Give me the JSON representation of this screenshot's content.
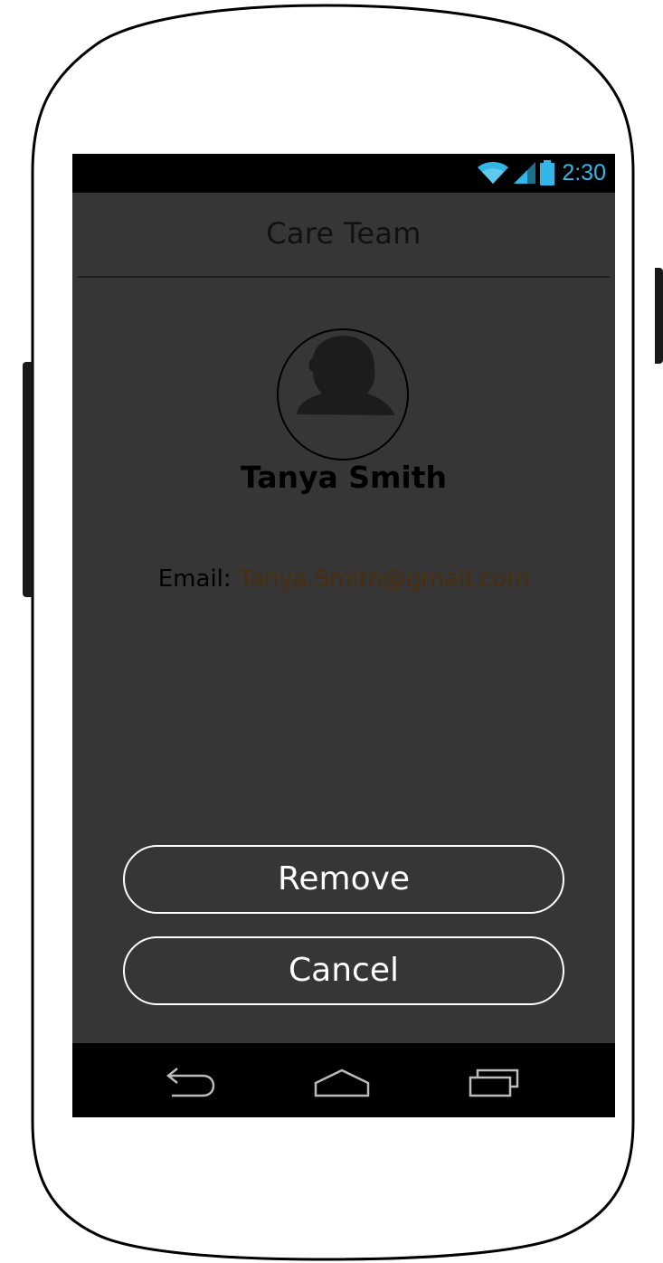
{
  "status_bar": {
    "time": "2:30",
    "icons": [
      "wifi-icon",
      "signal-icon",
      "battery-icon"
    ],
    "time_color": "#33b5e5"
  },
  "header": {
    "title": "Care Team"
  },
  "contact": {
    "name": "Tanya Smith",
    "avatar_icon": "user-silhouette-icon",
    "email_label": "Email:",
    "email_value": "Tanya.Smith@gmail.com"
  },
  "actions": {
    "remove_label": "Remove",
    "cancel_label": "Cancel"
  },
  "nav_bar": {
    "icons": [
      "back-icon",
      "home-icon",
      "recent-apps-icon"
    ]
  },
  "colors": {
    "screen_background": "#363636",
    "email_link": "#4a2e0d",
    "button_outline": "#ffffff"
  }
}
